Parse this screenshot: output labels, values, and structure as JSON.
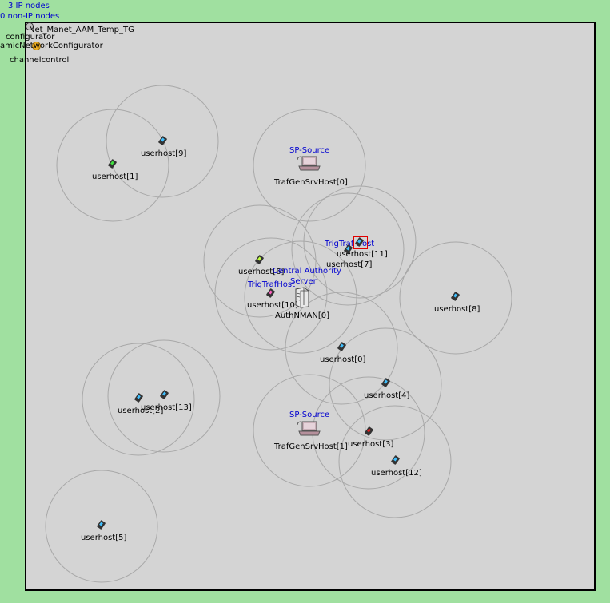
{
  "header": {
    "ip_nodes": "3 IP nodes",
    "non_ip_nodes": "0 non-IP nodes",
    "network_name": "Net_Manet_AAM_Temp_TG",
    "configurator": "configurator",
    "configurator_type": "amicNetworkConfigurator",
    "channelcontrol": "channelcontrol"
  },
  "nodes": {
    "userhost1": {
      "label": "userhost[1]",
      "screen": "#40e040"
    },
    "userhost9": {
      "label": "userhost[9]",
      "screen": "#40c0ff"
    },
    "userhost6": {
      "label": "userhost[6]",
      "screen": "#c0ff40"
    },
    "userhost7": {
      "label": "userhost[7]",
      "screen": "#40c0ff"
    },
    "userhost11": {
      "label": "userhost[11]",
      "screen": "#40c0ff"
    },
    "userhost10": {
      "label": "userhost[10]",
      "screen": "#ff60c0"
    },
    "userhost8": {
      "label": "userhost[8]",
      "screen": "#40c0ff"
    },
    "userhost0": {
      "label": "userhost[0]",
      "screen": "#40c0ff"
    },
    "userhost4": {
      "label": "userhost[4]",
      "screen": "#40c0ff"
    },
    "userhost3": {
      "label": "userhost[3]",
      "screen": "#e02020"
    },
    "userhost12": {
      "label": "userhost[12]",
      "screen": "#40c0ff"
    },
    "userhost2": {
      "label": "userhost[2]",
      "screen": "#40c0ff"
    },
    "userhost13": {
      "label": "userhost[13]",
      "screen": "#40c0ff"
    },
    "userhost5": {
      "label": "userhost[5]",
      "screen": "#40c0ff"
    },
    "trafgen0": {
      "label": "TrafGenSrvHost[0]",
      "tag": "SP-Source"
    },
    "trafgen1": {
      "label": "TrafGenSrvHost[1]",
      "tag": "SP-Source"
    },
    "authnman": {
      "label": "AuthNMAN[0]",
      "tag_line1": "Central Authority",
      "tag_line2": "Server"
    },
    "trig11_tag": "TrigTraf Host",
    "trig10_tag": "TrigTrafHost"
  },
  "colors": {
    "background": "#a0e0a0",
    "arena": "#d4d4d4",
    "tag_text": "#0000d0",
    "range_circle": "#a8a8a8",
    "selection": "#e00000"
  }
}
